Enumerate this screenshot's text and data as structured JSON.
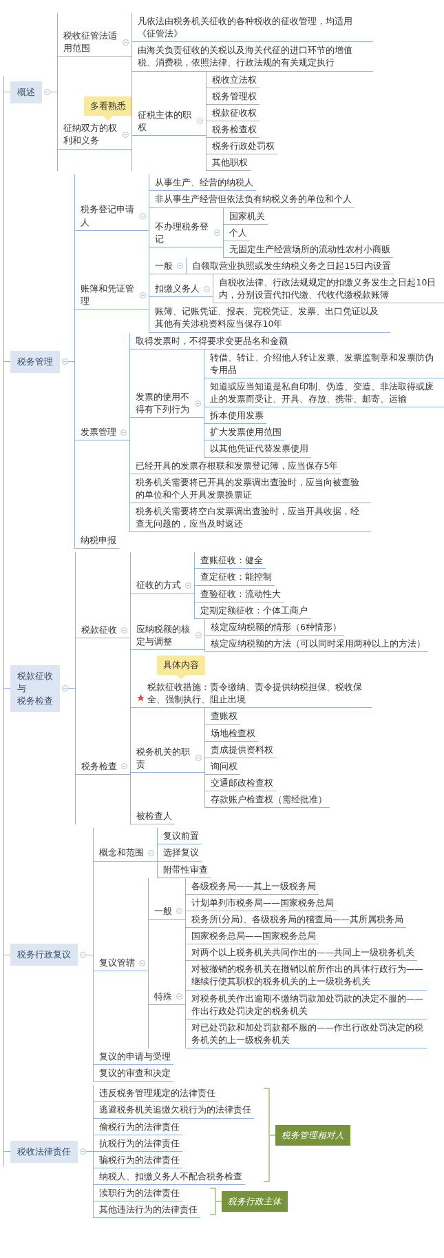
{
  "sections": [
    {
      "label": "概述",
      "children": [
        {
          "text": "税收征管法适用范围",
          "children": [
            {
              "text": "凡依法由税务机关征收的各种税收的征收管理，均适用《征管法》"
            },
            {
              "text": "由海关负责征收的关税以及海关代征的进口环节的增值税、消费税，依照法律、行政法规的有关规定执行"
            }
          ]
        },
        {
          "text": "征纳双方的权利和义务",
          "note": "多看熟悉",
          "children": [
            {
              "text": "征税主体的职权",
              "children": [
                {
                  "text": "税收立法权"
                },
                {
                  "text": "税务管理权"
                },
                {
                  "text": "税款征收权"
                },
                {
                  "text": "税务检查权"
                },
                {
                  "text": "税务行政处罚权"
                },
                {
                  "text": "其他职权"
                }
              ]
            }
          ]
        }
      ]
    },
    {
      "label": "税务管理",
      "children": [
        {
          "text": "税务登记申请人",
          "children": [
            {
              "text": "从事生产、经营的纳税人"
            },
            {
              "text": "非从事生产经营但依法负有纳税义务的单位和个人"
            },
            {
              "text": "不办理税务登记",
              "children": [
                {
                  "text": "国家机关"
                },
                {
                  "text": "个人"
                },
                {
                  "text": "无固定生产经营场所的流动性农村小商贩"
                }
              ]
            }
          ]
        },
        {
          "text": "账簿和凭证管理",
          "children": [
            {
              "text": "一般",
              "children": [
                {
                  "text": "自领取营业执照或发生纳税义务之日起15日内设置"
                }
              ]
            },
            {
              "text": "扣缴义务人",
              "children": [
                {
                  "text": "自税收法律、行政法规规定的扣缴义务发生之日起10日内，分别设置代扣代缴、代收代缴税款账簿"
                }
              ]
            },
            {
              "text": "账簿、记账凭证、报表、完税凭证、发票、出口凭证以及其他有关涉税资料应当保存10年"
            }
          ]
        },
        {
          "text": "发票管理",
          "children": [
            {
              "text": "取得发票时，不得要求变更品名和金额"
            },
            {
              "text": "发票的使用不得有下列行为",
              "children": [
                {
                  "text": "转借、转让、介绍他人转让发票、发票监制章和发票防伪专用品"
                },
                {
                  "text": "知道或应当知道是私自印制、伪造、变造、非法取得或废止的发票而受让、开具、存放、携带、邮寄、运输"
                },
                {
                  "text": "拆本使用发票"
                },
                {
                  "text": "扩大发票使用范围"
                },
                {
                  "text": "以其他凭证代替发票使用"
                }
              ]
            },
            {
              "text": "已经开具的发票存根联和发票登记簿，应当保存5年"
            },
            {
              "text": "税务机关需要将已开具的发票调出查验时，应当向被查验的单位和个人开具发票换票证"
            },
            {
              "text": "税务机关需要将空白发票调出查验时，应当开具收据，经查无问题的，应当及时返还"
            }
          ]
        },
        {
          "text": "纳税申报"
        }
      ]
    },
    {
      "label_lines": [
        "税款征收",
        "与",
        "税务检查"
      ],
      "children": [
        {
          "text": "税款征收",
          "children": [
            {
              "text": "征收的方式",
              "starred": false,
              "children": [
                {
                  "text": "查账征收：健全"
                },
                {
                  "text": "查定征收：能控制"
                },
                {
                  "text": "查验征收：流动性大"
                },
                {
                  "text": "定期定额征收：个体工商户"
                }
              ]
            },
            {
              "text": "应纳税额的核定与调整",
              "starred": false,
              "children": [
                {
                  "text": "核定应纳税额的情形（6种情形）"
                },
                {
                  "text": "核定应纳税额的方法（可以同时采用两种以上的方法）"
                }
              ]
            },
            {
              "text": "税款征收措施：责令缴纳、责令提供纳税担保、税收保全、强制执行、阻止出境",
              "note": "具体内容",
              "starred": true
            }
          ]
        },
        {
          "text": "税务检查",
          "children": [
            {
              "text": "税务机关的职责",
              "children": [
                {
                  "text": "查账权"
                },
                {
                  "text": "场地检查权"
                },
                {
                  "text": "责成提供资料权"
                },
                {
                  "text": "询问权"
                },
                {
                  "text": "交通邮政检查权"
                },
                {
                  "text": "存款账户检查权（需经批准）"
                }
              ]
            },
            {
              "text": "被检查人"
            }
          ]
        }
      ]
    },
    {
      "label": "税务行政复议",
      "children": [
        {
          "text": "概念和范围",
          "children": [
            {
              "text": "复议前置"
            },
            {
              "text": "选择复议"
            },
            {
              "text": "附带性审查"
            }
          ]
        },
        {
          "text": "复议管辖",
          "children": [
            {
              "text": "一般",
              "children": [
                {
                  "text": "各级税务局——其上一级税务局"
                },
                {
                  "text": "计划单列市税务局——国家税务总局"
                },
                {
                  "text": "税务所(分局)、各级税务局的稽查局——其所属税务局"
                },
                {
                  "text": "国家税务总局——国家税务总局"
                }
              ]
            },
            {
              "text": "特殊",
              "children": [
                {
                  "text": "对两个以上税务机关共同作出的——共同上一级税务机关"
                },
                {
                  "text": "对被撤销的税务机关在撤销以前所作出的具体行政行为——继续行使其职权的税务机关的上一级税务机关"
                },
                {
                  "text": "对税务机关作出逾期不缴纳罚款加处罚款的决定不服的——作出行政处罚决定的税务机关"
                },
                {
                  "text": "对已处罚款和加处罚款都不服的——作出行政处罚决定的税务机关的上一级税务机关"
                }
              ]
            }
          ]
        },
        {
          "text": "复议的申请与受理"
        },
        {
          "text": "复议的审查和决定"
        }
      ]
    },
    {
      "label": "税收法律责任",
      "groups": [
        {
          "summary": "税务管理相对人",
          "items": [
            {
              "text": "违反税务管理规定的法律责任"
            },
            {
              "text": "逃避税务机关追缴欠税行为的法律责任"
            },
            {
              "text": "偷税行为的法律责任"
            },
            {
              "text": "抗税行为的法律责任"
            },
            {
              "text": "骗税行为的法律责任"
            },
            {
              "text": "纳税人、扣缴义务人不配合税务检查"
            }
          ]
        },
        {
          "summary": "税务行政主体",
          "items": [
            {
              "text": "渎职行为的法律责任"
            },
            {
              "text": "其他违法行为的法律责任"
            }
          ]
        }
      ]
    }
  ]
}
